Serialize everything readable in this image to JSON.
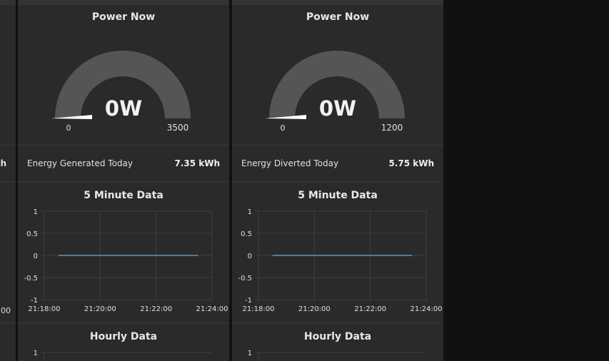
{
  "colors": {
    "background": "#111111",
    "panel": "#2a2a2a",
    "gauge_track": "#555555",
    "needle": "#ffffff",
    "series_line": "#3b7fbf",
    "grid": "#3d3d3d"
  },
  "left_fragment": {
    "stat_value_tail": "h",
    "tick_tail": ":00"
  },
  "panels": [
    {
      "gauge": {
        "title": "Power Now",
        "value": 0,
        "value_label": "0W",
        "min_label": "0",
        "max_label": "3500",
        "min": 0,
        "max": 3500
      },
      "stat": {
        "label": "Energy Generated Today",
        "value": "7.35 kWh"
      },
      "charts": [
        {
          "title": "5 Minute Data",
          "chart_data": {
            "type": "line",
            "title": "5 Minute Data",
            "ylim": [
              -1,
              1
            ],
            "yticks": [
              "1",
              "0.5",
              "0",
              "-0.5",
              "-1"
            ],
            "ytick_values": [
              1,
              0.5,
              0,
              -0.5,
              -1
            ],
            "xticks": [
              "21:18:00",
              "21:20:00",
              "21:22:00",
              "21:24:00"
            ],
            "xtick_minutes": [
              0,
              2,
              4,
              6
            ],
            "series": [
              {
                "x": [
                  "21:18:30",
                  "21:23:30"
                ],
                "x_minutes": [
                  0.5,
                  5.5
                ],
                "y": [
                  0,
                  0
                ]
              }
            ]
          }
        },
        {
          "title": "Hourly Data",
          "chart_data": {
            "type": "line",
            "title": "Hourly Data",
            "yticks": [
              "1"
            ]
          }
        }
      ]
    },
    {
      "gauge": {
        "title": "Power Now",
        "value": 0,
        "value_label": "0W",
        "min_label": "0",
        "max_label": "1200",
        "min": 0,
        "max": 1200
      },
      "stat": {
        "label": "Energy Diverted Today",
        "value": "5.75 kWh"
      },
      "charts": [
        {
          "title": "5 Minute Data",
          "chart_data": {
            "type": "line",
            "title": "5 Minute Data",
            "ylim": [
              -1,
              1
            ],
            "yticks": [
              "1",
              "0.5",
              "0",
              "-0.5",
              "-1"
            ],
            "ytick_values": [
              1,
              0.5,
              0,
              -0.5,
              -1
            ],
            "xticks": [
              "21:18:00",
              "21:20:00",
              "21:22:00",
              "21:24:00"
            ],
            "xtick_minutes": [
              0,
              2,
              4,
              6
            ],
            "series": [
              {
                "x": [
                  "21:18:30",
                  "21:23:30"
                ],
                "x_minutes": [
                  0.5,
                  5.5
                ],
                "y": [
                  0,
                  0
                ]
              }
            ]
          }
        },
        {
          "title": "Hourly Data",
          "chart_data": {
            "type": "line",
            "title": "Hourly Data",
            "yticks": [
              "1"
            ]
          }
        }
      ]
    }
  ]
}
